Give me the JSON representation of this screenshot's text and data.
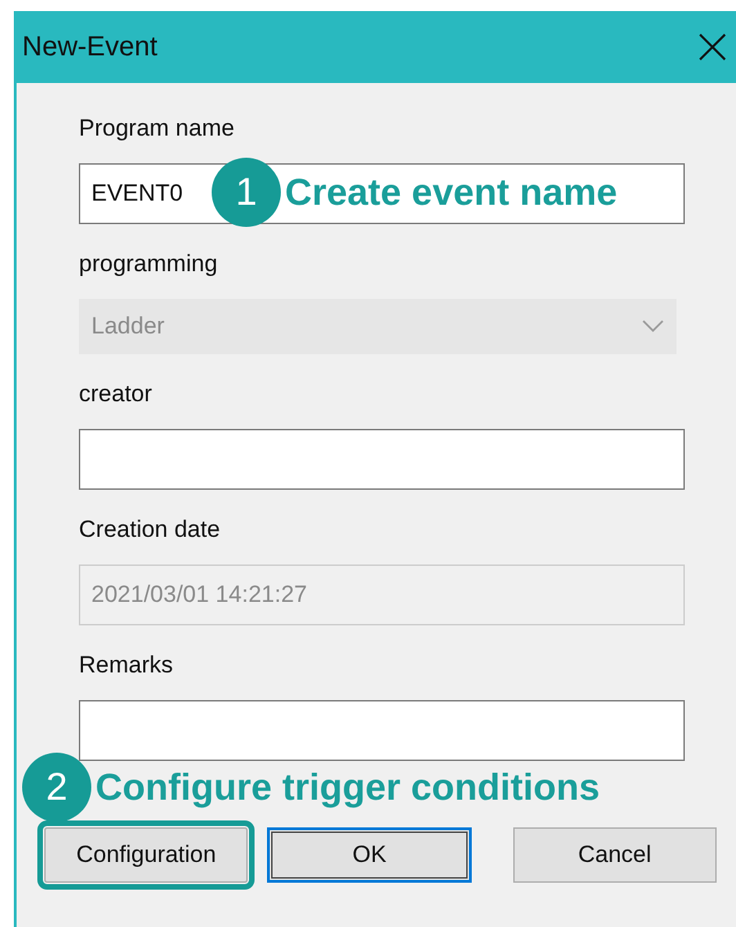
{
  "window": {
    "title": "New-Event"
  },
  "fields": [
    {
      "label": "Program name",
      "kind": "text",
      "value": "EVENT0",
      "disabled": false,
      "callout": {
        "number": "1",
        "text": "Create event name"
      }
    },
    {
      "label": "programming",
      "kind": "dropdown",
      "value": "Ladder",
      "disabled": true
    },
    {
      "label": "creator",
      "kind": "text",
      "disabled": false
    },
    {
      "label": "Creation date",
      "kind": "text",
      "value": "2021/03/01 14:21:27",
      "disabled": true
    },
    {
      "label": "Remarks",
      "kind": "text",
      "disabled": false
    }
  ],
  "footer_callout": {
    "number": "2",
    "text": "Configure trigger conditions"
  },
  "buttons": [
    {
      "label": "Configuration",
      "highlighted": true,
      "focused": false
    },
    {
      "label": "OK",
      "highlighted": false,
      "focused": true
    },
    {
      "label": "Cancel",
      "highlighted": false,
      "focused": false
    }
  ]
}
